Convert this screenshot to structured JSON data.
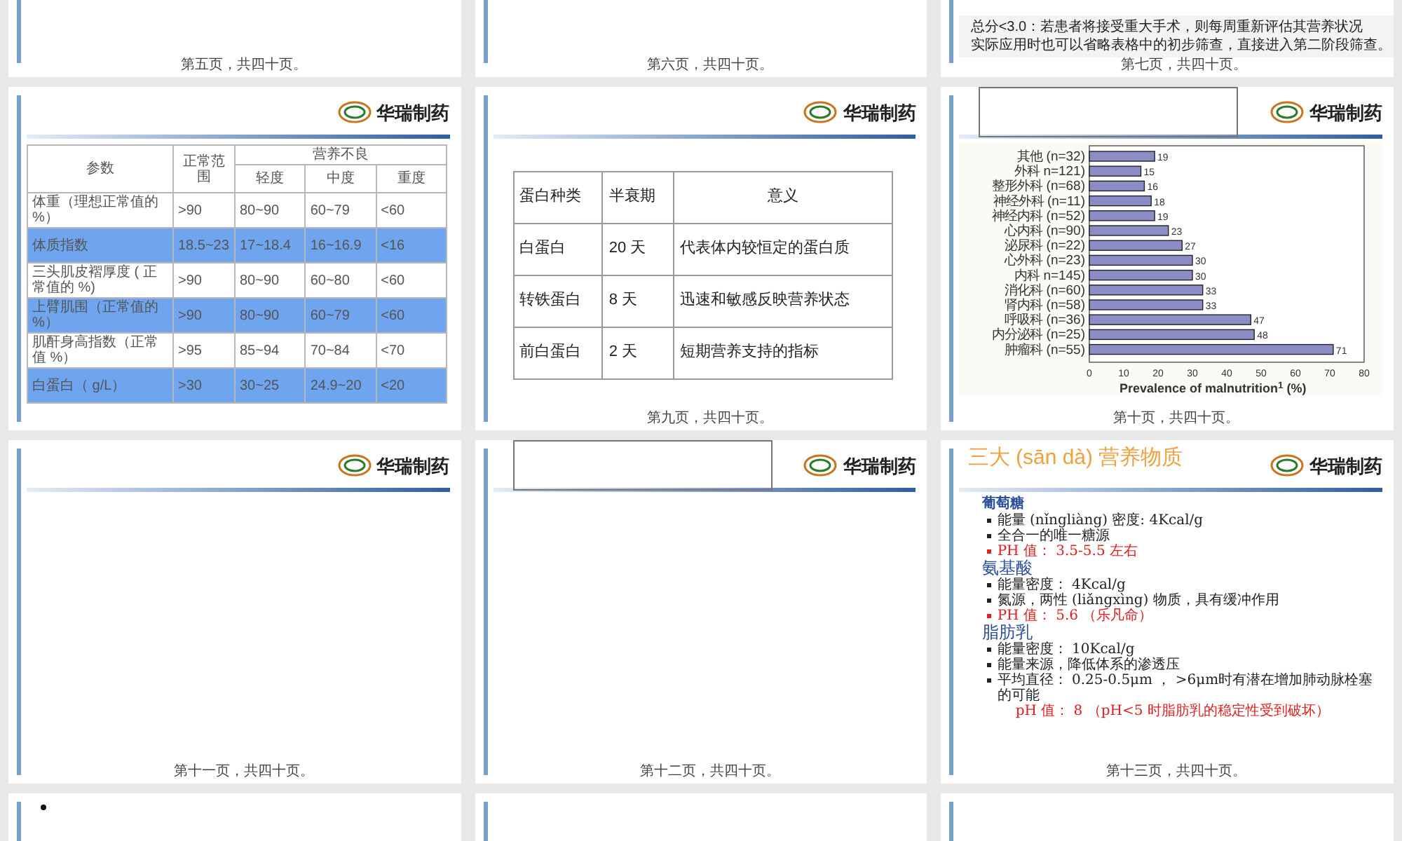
{
  "slides": [
    {
      "kind": "plain",
      "footer": "第五页，共四十页。"
    },
    {
      "kind": "plain",
      "footer": "第六页，共四十页。"
    },
    {
      "kind": "text",
      "lines": [
        "总分<3.0：若患者将接受重大手术，则每周重新评估其营养状况",
        "实际应用时也可以省略表格中的初步筛查，直接进入第二阶段筛查。"
      ],
      "footer": "第七页，共四十页。"
    },
    {
      "kind": "param_table",
      "logo": "华瑞制药",
      "outline_box": false,
      "table": {
        "columns": [
          "参数",
          "正常范围"
        ],
        "group": "营养不良",
        "subcolumns": [
          "轻度",
          "中度",
          "重度"
        ],
        "rows": [
          {
            "cells": [
              "体重（理想正常值的 %）",
              ">90",
              "80~90",
              "60~79",
              "<60"
            ],
            "highlighted": false
          },
          {
            "cells": [
              "体质指数",
              "18.5~23",
              "17~18.4",
              "16~16.9",
              "<16"
            ],
            "highlighted": true
          },
          {
            "cells": [
              "三头肌皮褶厚度 ( 正常值的 %)",
              ">90",
              "80~90",
              "60~80",
              "<60"
            ],
            "highlighted": false
          },
          {
            "cells": [
              "上臂肌围（正常值的 %）",
              ">90",
              "80~90",
              "60~79",
              "<60"
            ],
            "highlighted": true
          },
          {
            "cells": [
              "肌酐身高指数（正常值 %）",
              ">95",
              "85~94",
              "70~84",
              "<70"
            ],
            "highlighted": false
          },
          {
            "cells": [
              "白蛋白（ g/L）",
              ">30",
              "30~25",
              "24.9~20",
              "<20"
            ],
            "highlighted": true
          }
        ]
      }
    },
    {
      "kind": "protein_table",
      "logo": "华瑞制药",
      "outline_box": false,
      "table": {
        "columns": [
          "蛋白种类",
          "半衰期",
          "意义"
        ],
        "rows": [
          [
            "白蛋白",
            "20 天",
            "代表体内较恒定的蛋白质"
          ],
          [
            "转铁蛋白",
            "8 天",
            "迅速和敏感反映营养状态"
          ],
          [
            "前白蛋白",
            "2 天",
            "短期营养支持的指标"
          ]
        ]
      },
      "footer": "第九页，共四十页。"
    },
    {
      "kind": "chart",
      "logo": "华瑞制药",
      "outline_box": true,
      "chart_data": {
        "type": "bar",
        "orientation": "horizontal",
        "xlabel": "Prevalence of malnutrition$^{1}$ (%)",
        "categories": [
          "其他 (n=32)",
          "外科 n=121)",
          "整形外科 (n=68)",
          "神经外科 (n=11)",
          "神经内科 (n=52)",
          "心内科 (n=90)",
          "泌尿科 (n=22)",
          "心外科 (n=23)",
          "内科 n=145)",
          "消化科 (n=60)",
          "肾内科 (n=58)",
          "呼吸科 (n=36)",
          "内分泌科 (n=25)",
          "肿瘤科 (n=55)"
        ],
        "values": [
          19,
          15,
          16,
          18,
          19,
          23,
          27,
          30,
          30,
          33,
          33,
          47,
          48,
          71
        ],
        "xlim": [
          0,
          80
        ],
        "xticks": [
          0,
          10,
          20,
          30,
          40,
          50,
          60,
          70,
          80
        ],
        "data_labels": true
      },
      "footer": "第十页，共四十页。"
    },
    {
      "kind": "empty",
      "logo": "华瑞制药",
      "outline_box": false,
      "footer": "第十一页，共四十页。"
    },
    {
      "kind": "empty",
      "logo": "华瑞制药",
      "outline_box": true,
      "footer": "第十二页，共四十页。"
    },
    {
      "kind": "nutrients",
      "logo": "华瑞制药",
      "outline_box": false,
      "title": "三大 (sān dà) 营养物质",
      "sections": [
        {
          "heading": "葡萄糖",
          "items": [
            {
              "kind": "bullet",
              "text": "能量 (nǐngliàng) 密度: 4Kcal/g"
            },
            {
              "kind": "bullet",
              "text": "全合一的唯一糖源"
            },
            {
              "kind": "note",
              "text": "PH 值： 3.5-5.5 左右"
            }
          ]
        },
        {
          "heading": "氨基酸",
          "items": [
            {
              "kind": "bullet",
              "text": "能量密度： 4Kcal/g"
            },
            {
              "kind": "bullet",
              "text": "氮源，两性 (liǎngxìng) 物质，具有缓冲作用"
            },
            {
              "kind": "note",
              "text": "PH 值： 5.6 （乐凡命）"
            }
          ]
        },
        {
          "heading": "脂肪乳",
          "items": [
            {
              "kind": "bullet",
              "text": "能量密度： 10Kcal/g"
            },
            {
              "kind": "bullet",
              "text": "能量来源，降低体系的渗透压"
            },
            {
              "kind": "bullet",
              "text": "平均直径： 0.25-0.5μm ， >6μm时有潜在增加肺动脉栓塞的可能"
            },
            {
              "kind": "remark",
              "text": "pH 值： 8 （pH<5 时脂肪乳的稳定性受到破坏）"
            }
          ]
        }
      ],
      "footer": "第十三页，共四十页。"
    },
    {
      "kind": "bullet"
    },
    {
      "kind": "plain"
    },
    {
      "kind": "plain"
    }
  ]
}
